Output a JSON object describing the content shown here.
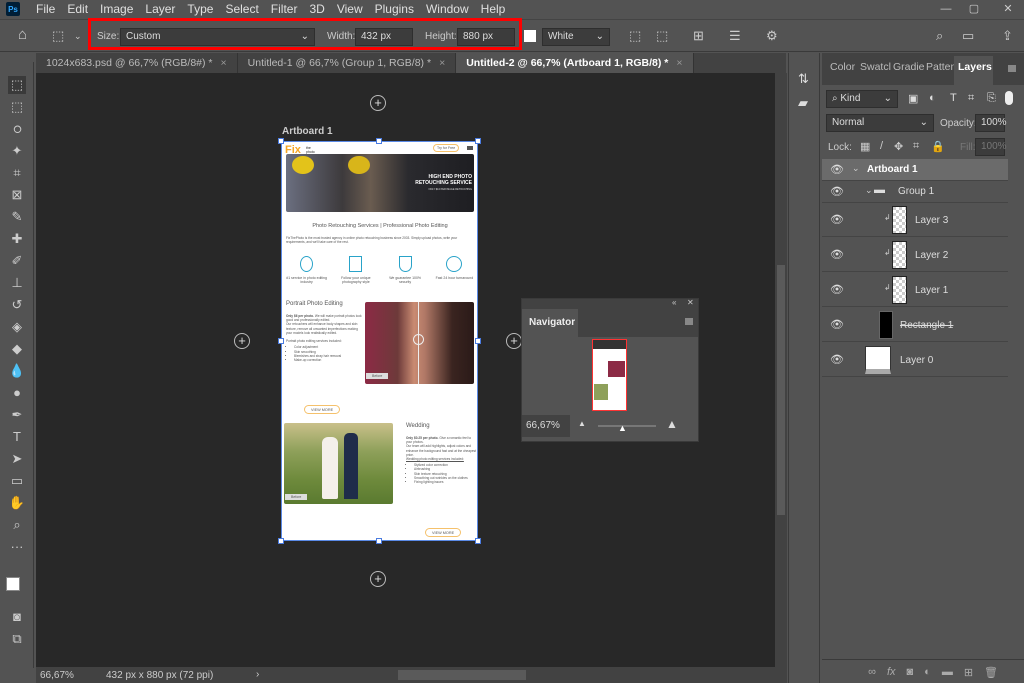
{
  "menu": [
    "File",
    "Edit",
    "Image",
    "Layer",
    "Type",
    "Select",
    "Filter",
    "3D",
    "View",
    "Plugins",
    "Window",
    "Help"
  ],
  "options": {
    "size_label": "Size:",
    "size_value": "Custom",
    "width_label": "Width:",
    "width_value": "432 px",
    "height_label": "Height:",
    "height_value": "880 px",
    "background_value": "White"
  },
  "tabs": [
    {
      "label": "1024x683.psd @ 66,7% (RGB/8#) *"
    },
    {
      "label": "Untitled-1 @ 66,7% (Group 1, RGB/8) *"
    },
    {
      "label": "Untitled-2 @ 66,7% (Artboard 1, RGB/8) *"
    }
  ],
  "artboard": {
    "label": "Artboard 1",
    "logo": "Fix",
    "logo_small": "the photo",
    "try_button": "Try for Free",
    "hero_title": "HIGH END PHOTO RETOUCHING SERVICE",
    "hero_sub": "ONLY $10 PER IMAGE RETOUCHING",
    "heading": "Photo Retouching Services | Professional Photo Editing",
    "intro": "FixThePhoto is the most trusted agency in online photo retouching business since 2003. Simply upload photos, write your requirements, and we'll take care of the rest.",
    "features": [
      "#1 service in photo editing industry",
      "Follow your unique photography style",
      "We guarantee 100% security",
      "Fast 24 hour turnaround"
    ],
    "portrait": {
      "title": "Portrait Photo Editing",
      "price": "Only $6 per photo.",
      "text1": "We will make portrait photos look good and professionally edited.",
      "text2": "Our retouchers will enhance body shapes and skin texture, remove all unwanted imperfections making your models look realistically edited.",
      "text3": "Portrait photo editing services included:",
      "list": [
        "Color adjustment",
        "Skin smoothing",
        "Blemishes and stray hair removal",
        "Make-up correction"
      ],
      "button": "VIEW MORE",
      "before": "Before"
    },
    "wedding": {
      "title": "Wedding",
      "price": "Only $0.25 per photo.",
      "text1": "Give a romantic feel to your photos.",
      "text2": "Our team will add highlights, adjust colors and enhance the background fast and at the cheapest price.",
      "text3": "Wedding photo editing services included:",
      "list": [
        "Stylized color correction",
        "Airbrushing",
        "Skin texture retouching",
        "Smoothing out wrinkles on the clothes",
        "Fixing lighting issues"
      ],
      "button": "VIEW MORE",
      "before": "Before"
    }
  },
  "navigator": {
    "title": "Navigator",
    "zoom": "66,67%",
    "zoom_slider_fraction": 0.45
  },
  "panel": {
    "tabs": [
      "Color",
      "Swatcl",
      "Gradie",
      "Patten",
      "Layers"
    ],
    "filter": "Kind",
    "blend": "Normal",
    "opacity_label": "Opacity:",
    "opacity": "100%",
    "lock_label": "Lock:",
    "fill_label": "Fill:",
    "fill": "100%",
    "layers": [
      {
        "name": "Artboard 1"
      },
      {
        "name": "Group 1"
      },
      {
        "name": "Layer 3"
      },
      {
        "name": "Layer 2"
      },
      {
        "name": "Layer 1"
      },
      {
        "name": "Rectangle 1"
      },
      {
        "name": "Layer 0"
      }
    ]
  },
  "status": {
    "zoom": "66,67%",
    "doc_info": "432 px x 880 px (72 ppi)"
  },
  "colors": {
    "highlight": "#ff0000",
    "accent": "#29a3c9",
    "orange": "#f5a623"
  }
}
